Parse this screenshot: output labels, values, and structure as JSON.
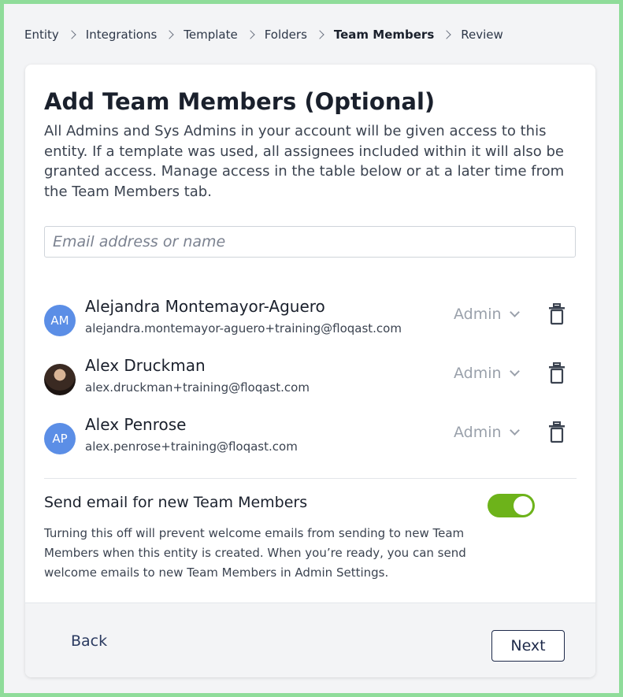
{
  "breadcrumb": {
    "items": [
      "Entity",
      "Integrations",
      "Template",
      "Folders",
      "Team Members",
      "Review"
    ],
    "active_index": 4
  },
  "page": {
    "title": "Add Team Members (Optional)",
    "description": "All Admins and Sys Admins in your account will be given access to this entity. If a template was used, all assignees included within it will also be granted access. Manage access in the table below or at a later time from the Team Members tab."
  },
  "search": {
    "placeholder": "Email address or name",
    "value": ""
  },
  "members": [
    {
      "initials": "AM",
      "name": "Alejandra Montemayor-Aguero",
      "email": "alejandra.montemayor-aguero+training@floqast.com",
      "role": "Admin",
      "avatar": "initials"
    },
    {
      "initials": "",
      "name": "Alex Druckman",
      "email": "alex.druckman+training@floqast.com",
      "role": "Admin",
      "avatar": "photo"
    },
    {
      "initials": "AP",
      "name": "Alex Penrose",
      "email": "alex.penrose+training@floqast.com",
      "role": "Admin",
      "avatar": "initials"
    }
  ],
  "email_toggle": {
    "label": "Send email for new Team Members",
    "enabled": true,
    "help": "Turning this off will prevent welcome emails from sending to new Team Members when this entity is created. When you’re ready, you can send welcome emails to new Team Members in Admin Settings."
  },
  "footer": {
    "back_label": "Back",
    "next_label": "Next"
  },
  "colors": {
    "frame_border": "#8fdc9a",
    "avatar_blue": "#5b8ee6",
    "toggle_on": "#6db31a",
    "primary_text": "#1e2a4a"
  },
  "icons": {
    "breadcrumb_separator": "chevron-right-icon",
    "role_dropdown": "chevron-down-icon",
    "remove_member": "trash-icon"
  }
}
